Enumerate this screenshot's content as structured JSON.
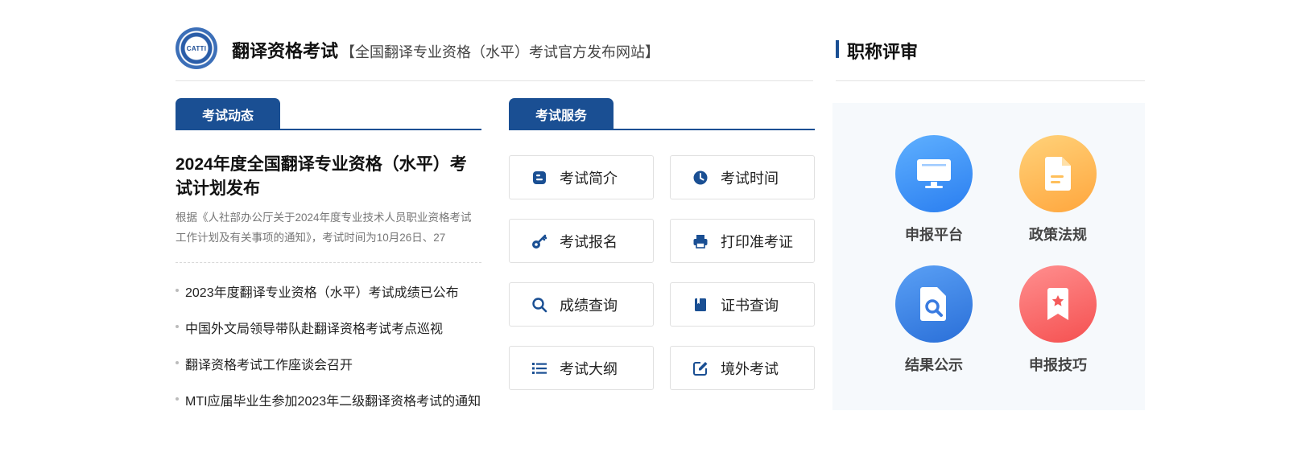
{
  "header": {
    "logo_text": "CATTI",
    "title": "翻译资格考试",
    "subtitle": "【全国翻译专业资格（水平）考试官方发布网站】"
  },
  "right": {
    "title": "职称评审",
    "items": [
      {
        "label": "申报平台",
        "icon": "monitor-icon"
      },
      {
        "label": "政策法规",
        "icon": "document-icon"
      },
      {
        "label": "结果公示",
        "icon": "file-search-icon"
      },
      {
        "label": "申报技巧",
        "icon": "bookmark-star-icon"
      }
    ]
  },
  "news": {
    "tab": "考试动态",
    "featured_title": "2024年度全国翻译专业资格（水平）考试计划发布",
    "featured_summary": "根据《人社部办公厅关于2024年度专业技术人员职业资格考试工作计划及有关事项的通知》，考试时间为10月26日、27",
    "items": [
      "2023年度翻译专业资格（水平）考试成绩已公布",
      "中国外文局领导带队赴翻译资格考试考点巡视",
      "翻译资格考试工作座谈会召开",
      "MTI应届毕业生参加2023年二级翻译资格考试的通知"
    ]
  },
  "services": {
    "tab": "考试服务",
    "items": [
      {
        "label": "考试简介",
        "icon": "blogger-icon"
      },
      {
        "label": "考试时间",
        "icon": "clock-icon"
      },
      {
        "label": "考试报名",
        "icon": "key-icon"
      },
      {
        "label": "打印准考证",
        "icon": "printer-icon"
      },
      {
        "label": "成绩查询",
        "icon": "search-icon"
      },
      {
        "label": "证书查询",
        "icon": "book-icon"
      },
      {
        "label": "考试大纲",
        "icon": "list-icon"
      },
      {
        "label": "境外考试",
        "icon": "edit-icon"
      }
    ]
  },
  "colors": {
    "primary": "#1a4f93"
  }
}
